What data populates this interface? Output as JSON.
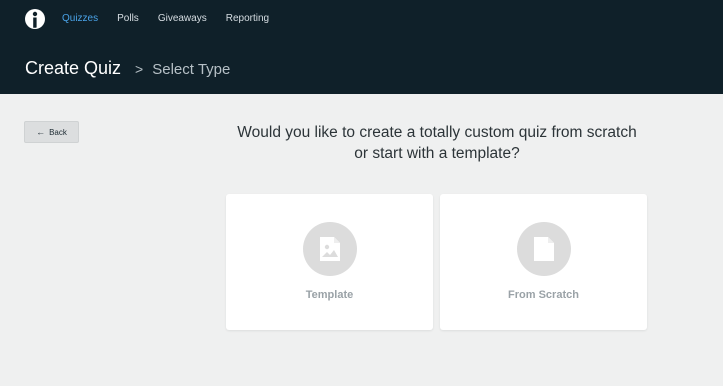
{
  "header": {
    "nav": [
      {
        "label": "Quizzes",
        "active": true
      },
      {
        "label": "Polls",
        "active": false
      },
      {
        "label": "Giveaways",
        "active": false
      },
      {
        "label": "Reporting",
        "active": false
      }
    ],
    "title": "Create Quiz",
    "separator": ">",
    "breadcrumb": "Select Type"
  },
  "back_button": {
    "icon": "arrow-left-icon",
    "label": "Back"
  },
  "question": {
    "line1": "Would you like to create a totally custom quiz from scratch",
    "line2": "or start with a template?"
  },
  "options": [
    {
      "label": "Template",
      "icon": "image-document-icon"
    },
    {
      "label": "From Scratch",
      "icon": "blank-document-icon"
    }
  ],
  "colors": {
    "header_bg": "#0f2029",
    "accent": "#4aa3e8",
    "page_bg": "#eff0f0",
    "icon_circle": "#dcdcdc"
  }
}
